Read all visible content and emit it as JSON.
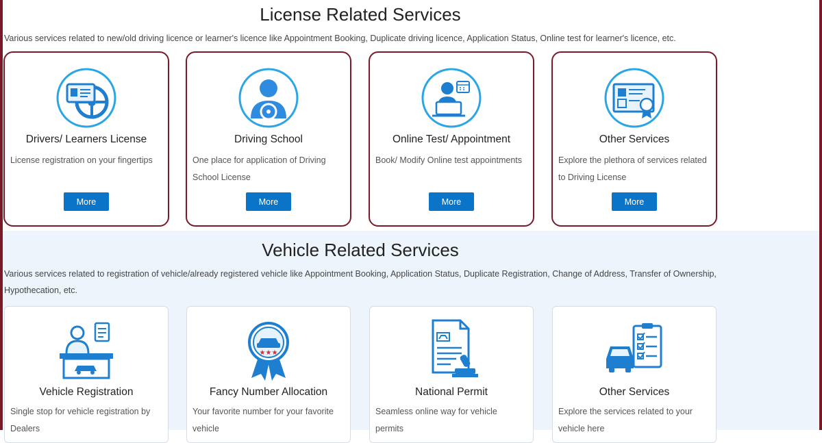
{
  "license": {
    "title": "License Related Services",
    "description": "Various services related to new/old driving licence or learner's licence like Appointment Booking, Duplicate driving licence, Application Status, Online test for learner's licence, etc.",
    "cards": [
      {
        "title": "Drivers/ Learners License",
        "desc": "License registration on your fingertips",
        "button": "More",
        "icon": "license-steering-icon"
      },
      {
        "title": "Driving School",
        "desc": "One place for application of Driving School License",
        "button": "More",
        "icon": "driver-icon"
      },
      {
        "title": "Online Test/ Appointment",
        "desc": "Book/ Modify Online test appointments",
        "button": "More",
        "icon": "online-test-icon"
      },
      {
        "title": "Other Services",
        "desc": "Explore the plethora of services related to Driving License",
        "button": "More",
        "icon": "certificate-icon"
      }
    ]
  },
  "vehicle": {
    "title": "Vehicle Related Services",
    "description": "Various services related to registration of vehicle/already registered vehicle like Appointment Booking, Application Status, Duplicate Registration, Change of Address, Transfer of Ownership, Hypothecation, etc.",
    "cards": [
      {
        "title": "Vehicle Registration",
        "desc": "Single stop for vehicle registration by Dealers",
        "icon": "dealer-desk-icon"
      },
      {
        "title": "Fancy Number Allocation",
        "desc": "Your favorite number for your favorite vehicle",
        "icon": "badge-car-icon"
      },
      {
        "title": "National Permit",
        "desc": "Seamless online way for vehicle permits",
        "icon": "permit-stamp-icon"
      },
      {
        "title": "Other Services",
        "desc": "Explore the services related to your vehicle here",
        "icon": "car-checklist-icon"
      }
    ]
  },
  "colors": {
    "accent": "#0a74c8",
    "border": "#7a1a28",
    "icon_blue": "#1e7fd0",
    "vehicle_bg": "#eef4fb"
  }
}
